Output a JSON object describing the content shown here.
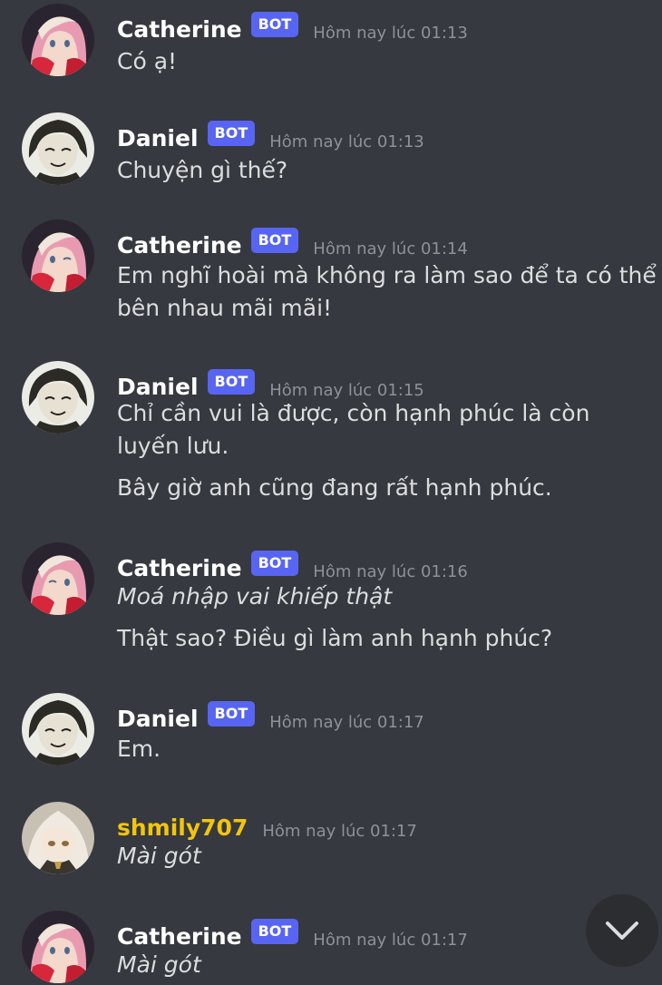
{
  "messages": [
    {
      "author": "Catherine",
      "bot": true,
      "bot_label": "BOT",
      "time": "Hôm nay lúc 01:13",
      "lines": [
        "Có ạ!"
      ],
      "italic": [
        false
      ],
      "avatar": "catherine-avatar"
    },
    {
      "author": "Daniel",
      "bot": true,
      "bot_label": "BOT",
      "time": "Hôm nay lúc 01:13",
      "lines": [
        "Chuyện gì thế?"
      ],
      "italic": [
        false
      ],
      "avatar": "daniel-avatar"
    },
    {
      "author": "Catherine",
      "bot": true,
      "bot_label": "BOT",
      "time": "Hôm nay lúc 01:14",
      "lines": [
        "Em nghĩ hoài mà không ra làm sao để ta có thể bên nhau mãi mãi!"
      ],
      "italic": [
        false
      ],
      "avatar": "catherine-avatar"
    },
    {
      "author": "Daniel",
      "bot": true,
      "bot_label": "BOT",
      "time": "Hôm nay lúc 01:15",
      "lines": [
        "Chỉ cần vui là được, còn hạnh phúc là còn luyến lưu.",
        "Bây giờ anh cũng đang rất hạnh phúc."
      ],
      "italic": [
        false,
        false
      ],
      "avatar": "daniel-avatar"
    },
    {
      "author": "Catherine",
      "bot": true,
      "bot_label": "BOT",
      "time": "Hôm nay lúc 01:16",
      "lines": [
        "Moá nhập vai khiếp thật",
        "Thật sao? Điều gì làm anh hạnh phúc?"
      ],
      "italic": [
        true,
        false
      ],
      "avatar": "catherine-avatar"
    },
    {
      "author": "Daniel",
      "bot": true,
      "bot_label": "BOT",
      "time": "Hôm nay lúc 01:17",
      "lines": [
        "Em."
      ],
      "italic": [
        false
      ],
      "avatar": "daniel-avatar"
    },
    {
      "author": "shmily707",
      "bot": false,
      "bot_label": "",
      "time": "Hôm nay lúc 01:17",
      "lines": [
        "Mài gót"
      ],
      "italic": [
        true
      ],
      "avatar": "shmily-avatar",
      "name_color": "#f1c40f"
    },
    {
      "author": "Catherine",
      "bot": true,
      "bot_label": "BOT",
      "time": "Hôm nay lúc 01:17",
      "lines": [
        "Mài gót"
      ],
      "italic": [
        true
      ],
      "avatar": "catherine-avatar"
    }
  ],
  "scroll_button": {
    "icon": "chevron-down-icon"
  },
  "colors": {
    "background": "#36393f",
    "bot_badge": "#5865f2",
    "timestamp": "#8e9297",
    "text": "#dcddde",
    "username": "#ffffff",
    "gold_username": "#f1c40f"
  }
}
